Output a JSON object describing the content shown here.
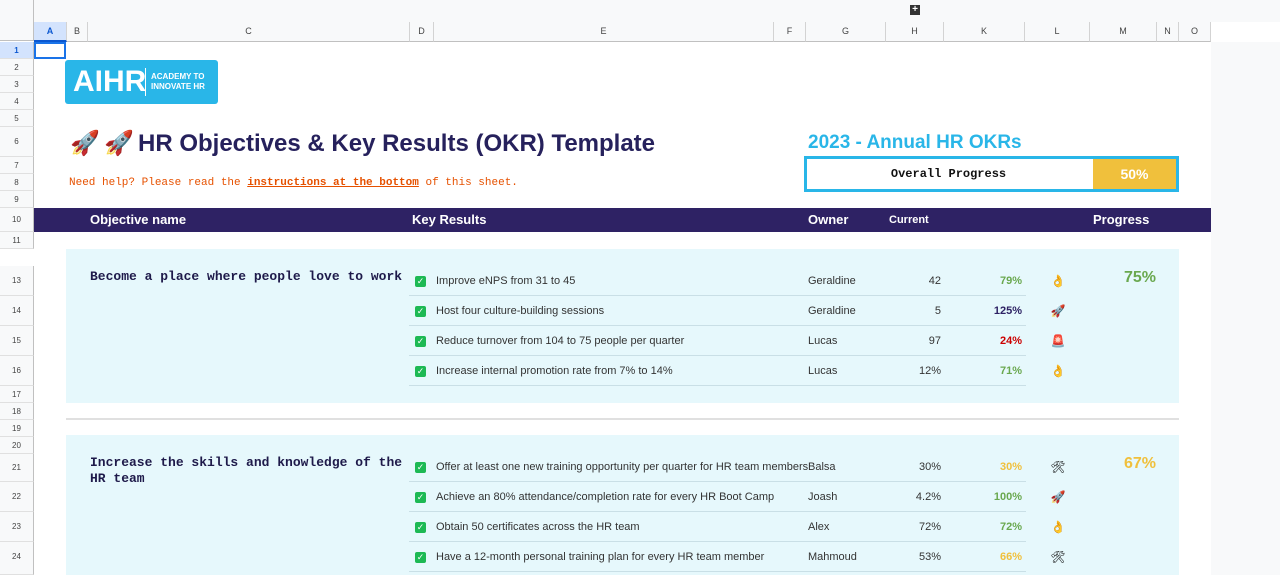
{
  "sheet": {
    "columns": [
      "A",
      "B",
      "C",
      "D",
      "E",
      "F",
      "G",
      "H",
      "K",
      "L",
      "M",
      "N",
      "O"
    ],
    "rows": [
      "1",
      "2",
      "3",
      "4",
      "5",
      "6",
      "7",
      "8",
      "9",
      "10",
      "11",
      "13",
      "14",
      "15",
      "16",
      "17",
      "18",
      "19",
      "20",
      "21",
      "22",
      "23",
      "24"
    ],
    "selected_column": "A",
    "selected_row": "1",
    "add_button": "+"
  },
  "logo": {
    "big": "AIHR",
    "line1": "ACADEMY TO",
    "line2": "INNOVATE HR"
  },
  "title": {
    "emoji": "🚀",
    "text": "HR Objectives & Key Results (OKR) Template"
  },
  "help": {
    "prefix": "Need help? Please read the ",
    "link": "instructions at the bottom",
    "suffix": " of this sheet."
  },
  "summary": {
    "year_title": "2023 - Annual HR OKRs",
    "overall_label": "Overall Progress",
    "overall_value": "50%"
  },
  "header": {
    "objective": "Objective name",
    "key_results": "Key Results",
    "owner": "Owner",
    "current": "Current",
    "progress": "Progress"
  },
  "objectives": [
    {
      "name": "Become a place where people love to work",
      "progress": "75%",
      "key_results": [
        {
          "text": "Improve eNPS from 31 to 45",
          "owner": "Geraldine",
          "current": "42",
          "pct": "79%",
          "icon": "👌"
        },
        {
          "text": "Host four culture-building sessions",
          "owner": "Geraldine",
          "current": "5",
          "pct": "125%",
          "icon": "🚀"
        },
        {
          "text": "Reduce turnover from 104 to 75 people per quarter",
          "owner": "Lucas",
          "current": "97",
          "pct": "24%",
          "icon": "🚨"
        },
        {
          "text": "Increase internal promotion rate from 7% to 14%",
          "owner": "Lucas",
          "current": "12%",
          "pct": "71%",
          "icon": "👌"
        }
      ]
    },
    {
      "name": "Increase the skills and knowledge of the HR team",
      "progress": "67%",
      "key_results": [
        {
          "text": "Offer at least one new training opportunity per quarter for HR team members",
          "owner": "Balsa",
          "current": "30%",
          "pct": "30%",
          "icon": "🛠"
        },
        {
          "text": "Achieve an 80% attendance/completion rate for every HR Boot Camp",
          "owner": "Joash",
          "current": "4.2%",
          "pct": "100%",
          "icon": "🚀"
        },
        {
          "text": "Obtain 50 certificates across the HR team",
          "owner": "Alex",
          "current": "72%",
          "pct": "72%",
          "icon": "👌"
        },
        {
          "text": "Have a 12-month personal training plan for every HR team member",
          "owner": "Mahmoud",
          "current": "53%",
          "pct": "66%",
          "icon": "🛠"
        }
      ]
    }
  ],
  "colors": {
    "navy": "#2e2264",
    "cyan": "#29b6e8",
    "gold": "#f0c03c",
    "green": "#6aa84f",
    "red": "#cc0000"
  }
}
